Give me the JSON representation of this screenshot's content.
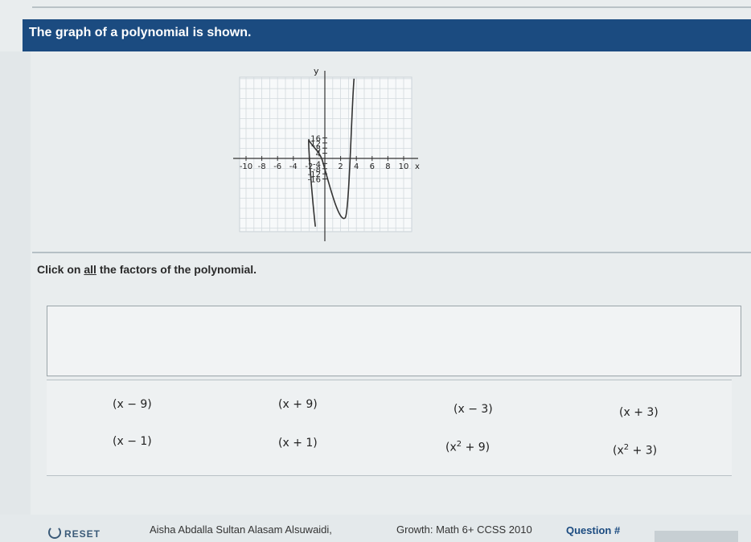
{
  "header": {
    "title": "The graph of a polynomial is shown."
  },
  "graph": {
    "y_label": "y",
    "x_label": "x",
    "x_ticks": [
      "-10",
      "-8",
      "-6",
      "-4",
      "-2",
      "2",
      "4",
      "6",
      "8",
      "10"
    ],
    "y_ticks": [
      "16",
      "12",
      "8",
      "4",
      "-4",
      "-8",
      "-12",
      "-16"
    ]
  },
  "prompt": {
    "before": "Click on ",
    "emph": "all",
    "after": " the factors of the polynomial."
  },
  "choices": [
    {
      "label": "(x − 9)"
    },
    {
      "label": "(x + 9)"
    },
    {
      "label": "(x − 3)"
    },
    {
      "label": "(x + 3)"
    },
    {
      "label": "(x − 1)"
    },
    {
      "label": "(x + 1)"
    },
    {
      "base": "(x",
      "exp": "2",
      "rest": " + 9)"
    },
    {
      "base": "(x",
      "exp": "2",
      "rest": " + 3)"
    }
  ],
  "footer": {
    "reset_label": "RESET",
    "student": "Aisha Abdalla Sultan Alasam Alsuwaidi,",
    "course": "Growth: Math 6+ CCSS 2010",
    "question": "Question #"
  }
}
